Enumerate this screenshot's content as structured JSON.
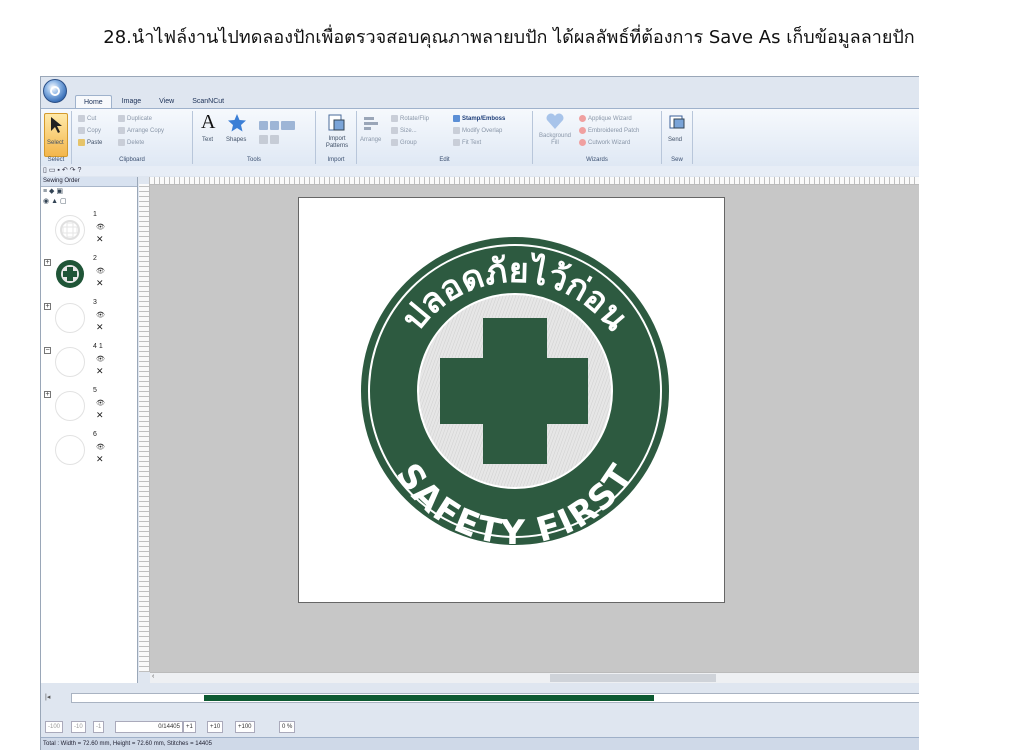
{
  "caption": "28.นำไฟล์งานไปทดลองปักเพื่อตรวจสอบคุณภาพลายบปัก ได้ผลลัพธ์ที่ต้องการ Save As เก็บข้อมูลลายปัก",
  "tabs": [
    "Home",
    "Image",
    "View",
    "ScanNCut"
  ],
  "active_tab": "Home",
  "ribbon": {
    "select": {
      "label": "Select",
      "group": "Select"
    },
    "clipboard": {
      "cut": "Cut",
      "copy": "Copy",
      "paste": "Paste",
      "duplicate": "Duplicate",
      "arrange_copy": "Arrange Copy",
      "delete": "Delete",
      "group": "Clipboard"
    },
    "tools": {
      "text": "Text",
      "shapes": "Shapes",
      "group": "Tools"
    },
    "import": {
      "label": "Import Patterns",
      "group": "Import"
    },
    "edit": {
      "arrange": "Arrange",
      "rotate": "Rotate/Flip",
      "size": "Size...",
      "group_btn": "Group",
      "stamp": "Stamp/Emboss",
      "modify_overlap": "Modify Overlap",
      "fit_text": "Fit Text",
      "group": "Edit"
    },
    "wizards": {
      "background_fill": "Background Fill",
      "applique": "Applique Wizard",
      "embroidered_patch": "Embroidered Patch",
      "cutwork": "Cutwork Wizard",
      "group": "Wizards"
    },
    "sew": {
      "send": "Send",
      "group": "Sew"
    }
  },
  "sewing_order": {
    "title": "Sewing Order",
    "items": [
      {
        "num": "1",
        "expand": ""
      },
      {
        "num": "2",
        "expand": "⊞"
      },
      {
        "num": "3",
        "expand": "⊞"
      },
      {
        "num": "4 1",
        "expand": "⊟"
      },
      {
        "num": "5",
        "expand": "⊞"
      },
      {
        "num": "6",
        "expand": ""
      }
    ]
  },
  "patch": {
    "top_text": "ปลอดภัยไว้ก่อน",
    "bottom_text": "SAFETY FIRST",
    "color": "#2d5a40"
  },
  "simulator": {
    "progress_color": "#0d5a32"
  },
  "stepbar": {
    "b1": "-100",
    "b2": "-10",
    "b3": "-1",
    "counter": "0/14405",
    "f1": "+1",
    "f2": "+10",
    "f3": "+100",
    "zoom": "0 %"
  },
  "status": "Total : Width = 72.60 mm, Height = 72.60 mm, Stitches = 14405"
}
